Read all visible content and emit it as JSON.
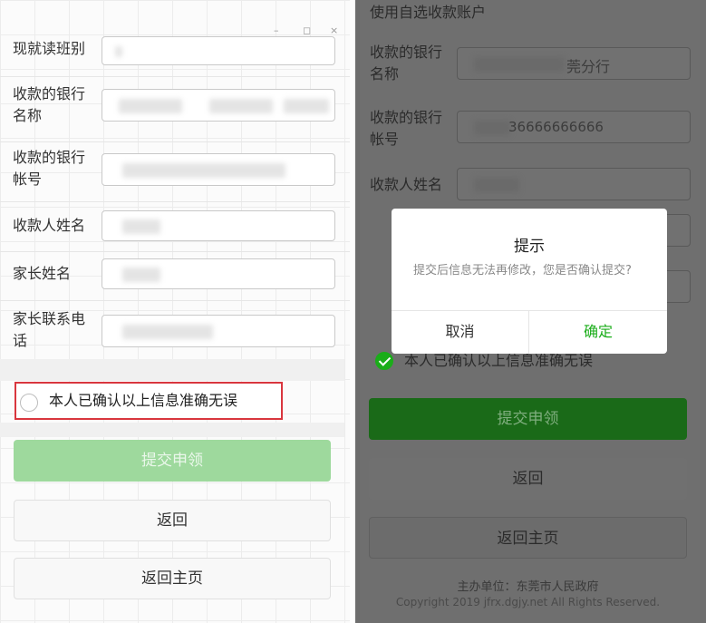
{
  "left": {
    "window_controls": [
      "–",
      "◻",
      "×"
    ],
    "form": {
      "class_label": "现就读班别",
      "bank_name_label": "收款的银行名称",
      "bank_account_label": "收款的银行帐号",
      "payee_name_label": "收款人姓名",
      "parent_name_label": "家长姓名",
      "parent_phone_label": "家长联系电话"
    },
    "confirm_text": "本人已确认以上信息准确无误",
    "confirm_checked": false,
    "submit_label": "提交申领",
    "back_label": "返回",
    "home_label": "返回主页"
  },
  "right": {
    "top_text": "使用自选收款账户",
    "form": {
      "bank_name_label": "收款的银行名称",
      "bank_name_value_partial": "莞分行",
      "bank_account_label": "收款的银行帐号",
      "bank_account_value_partial": "36666666666",
      "payee_name_label": "收款人姓名"
    },
    "confirm_text": "本人已确认以上信息准确无误",
    "confirm_checked": true,
    "submit_label": "提交申领",
    "back_label": "返回",
    "home_label": "返回主页",
    "footer": {
      "sponsor": "主办单位：东莞市人民政府",
      "copyright": "Copyright 2019 jfrx.dgjy.net All Rights Reserved."
    },
    "dialog": {
      "title": "提示",
      "message": "提交后信息无法再修改，您是否确认提交?",
      "cancel_label": "取消",
      "confirm_label": "确定"
    }
  },
  "colors": {
    "accent_green": "#1aad19",
    "disabled_green": "#9ed99d",
    "highlight_red": "#d9363e"
  }
}
